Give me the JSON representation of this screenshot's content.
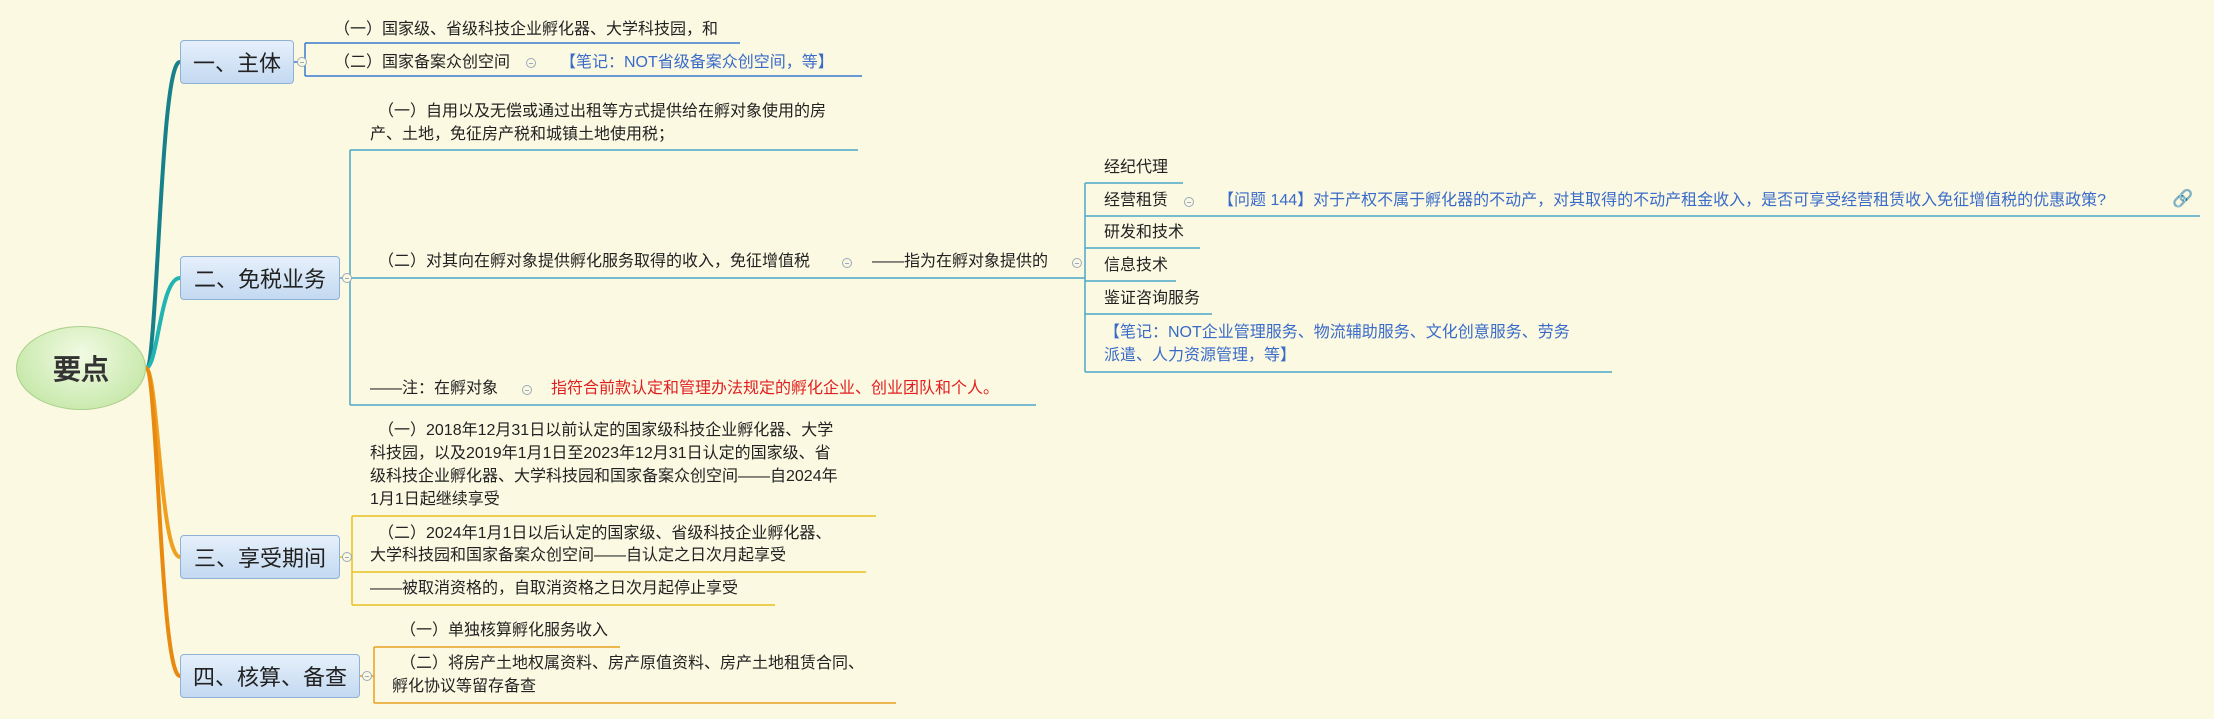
{
  "root": {
    "label": "要点"
  },
  "topics": [
    {
      "label": "一、主体",
      "items": [
        "（一）国家级、省级科技企业孵化器、大学科技园，和",
        "（二）国家备案众创空间",
        "【笔记：NOT省级备案众创空间，等】"
      ]
    },
    {
      "label": "二、免税业务",
      "item1": [
        "（一）自用以及无偿或通过出租等方式提供给在孵对象使用的房",
        "产、土地，免征房产税和城镇土地使用税；"
      ],
      "item2": "（二）对其向在孵对象提供孵化服务取得的收入，免征增值税",
      "item2_sub": "——指为在孵对象提供的",
      "services": [
        "经纪代理",
        "经营租赁",
        "研发和技术",
        "信息技术",
        "鉴证咨询服务"
      ],
      "question": "【问题 144】对于产权不属于孵化器的不动产，对其取得的不动产租金收入，是否可享受经营租赁收入免征增值税的优惠政策?",
      "note": [
        "【笔记：NOT企业管理服务、物流辅助服务、文化创意服务、劳务",
        "派遣、人力资源管理，等】"
      ],
      "item3": "——注：在孵对象",
      "item3_red": "指符合前款认定和管理办法规定的孵化企业、创业团队和个人。"
    },
    {
      "label": "三、享受期间",
      "item1": [
        "（一）2018年12月31日以前认定的国家级科技企业孵化器、大学",
        "科技园，以及2019年1月1日至2023年12月31日认定的国家级、省",
        "级科技企业孵化器、大学科技园和国家备案众创空间——自2024年",
        "1月1日起继续享受"
      ],
      "item2": [
        "（二）2024年1月1日以后认定的国家级、省级科技企业孵化器、",
        "大学科技园和国家备案众创空间——自认定之日次月起享受"
      ],
      "item3": "——被取消资格的，自取消资格之日次月起停止享受"
    },
    {
      "label": "四、核算、备查",
      "item1": "（一）单独核算孵化服务收入",
      "item2": [
        "（二）将房产土地权属资料、房产原值资料、房产土地租赁合同、",
        "孵化协议等留存备查"
      ]
    }
  ],
  "colors": {
    "background": "#fbf9e2",
    "branch1": "#17808a",
    "branch2": "#22b3b3",
    "branch3": "#f0a020",
    "branch4": "#e88a10",
    "note": "#3a6bc9",
    "highlight": "#e02020"
  }
}
